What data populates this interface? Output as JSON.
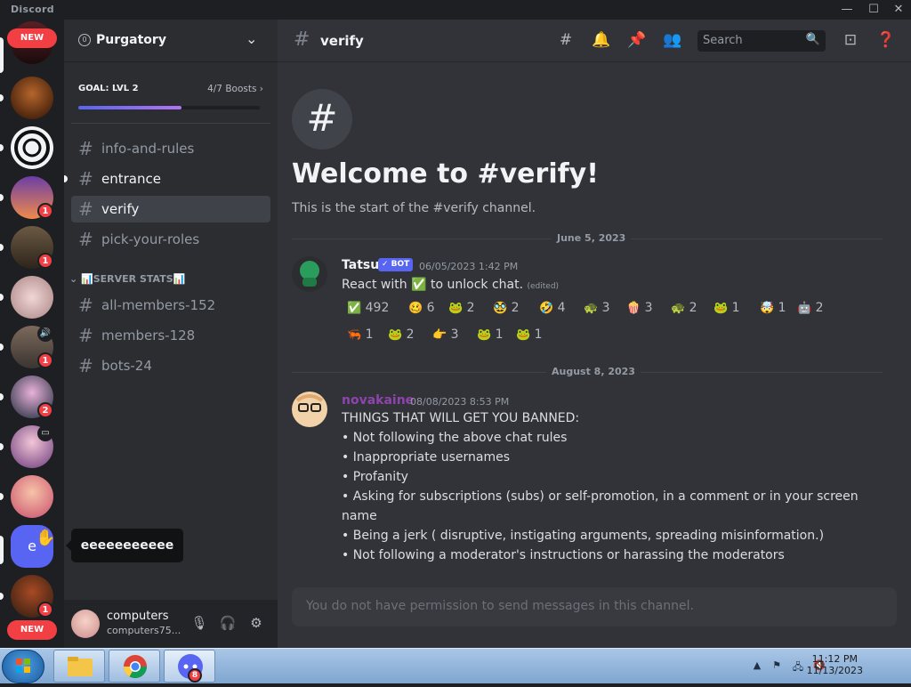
{
  "window": {
    "title": "Discord",
    "minimize": "—",
    "maximize": "☐",
    "close": "✕"
  },
  "rail": {
    "new_top": "NEW",
    "new_bottom": "NEW",
    "badges": [
      "1",
      "1",
      "1",
      "2",
      "1"
    ],
    "tooltip": "eeeeeeeeeee",
    "hovered_server_letter": "e"
  },
  "guild": {
    "name": "Purgatory",
    "goal": "GOAL: LVL 2",
    "boosts": "4/7 Boosts",
    "boost_progress": 0.57
  },
  "channels": {
    "top": [
      {
        "name": "info-and-rules"
      },
      {
        "name": "entrance"
      },
      {
        "name": "verify"
      },
      {
        "name": "pick-your-roles"
      }
    ],
    "category": "SERVER STATS",
    "stats": [
      {
        "name": "all-members-152"
      },
      {
        "name": "members-128"
      },
      {
        "name": "bots-24"
      }
    ]
  },
  "user": {
    "name": "computers",
    "tag": "computers75..."
  },
  "header": {
    "channel": "verify",
    "search_placeholder": "Search"
  },
  "welcome": {
    "title": "Welcome to #verify!",
    "subtitle": "This is the start of the #verify channel."
  },
  "messages": [
    {
      "date": "June 5, 2023",
      "author": "Tatsu",
      "author_color": "#f2f3f5",
      "bot": "✓ BOT",
      "timestamp": "06/05/2023 1:42 PM",
      "text_before": "React with",
      "text_after": "to unlock chat.",
      "edited": "(edited)",
      "reactions": [
        {
          "emoji": "✅",
          "count": "492"
        },
        {
          "emoji": "🥴",
          "count": "6"
        },
        {
          "emoji": "🐸",
          "count": "2"
        },
        {
          "emoji": "🥸",
          "count": "2"
        },
        {
          "emoji": "🤣",
          "count": "4"
        },
        {
          "emoji": "🐢",
          "count": "3"
        },
        {
          "emoji": "🍿",
          "count": "3"
        },
        {
          "emoji": "🐢",
          "count": "2"
        },
        {
          "emoji": "🐸",
          "count": "1"
        },
        {
          "emoji": "🤯",
          "count": "1"
        },
        {
          "emoji": "🤖",
          "count": "2"
        },
        {
          "emoji": "🦐",
          "count": "1"
        },
        {
          "emoji": "🐸",
          "count": "2"
        },
        {
          "emoji": "👉",
          "count": "3"
        },
        {
          "emoji": "🐸",
          "count": "1"
        },
        {
          "emoji": "🐸",
          "count": "1"
        }
      ]
    },
    {
      "date": "August 8, 2023",
      "author": "novakaine",
      "author_color": "#8e44ad",
      "timestamp": "08/08/2023 8:53 PM",
      "lines": [
        "THINGS THAT WILL GET YOU BANNED:",
        "• Not following the above chat rules",
        "• Inappropriate usernames",
        "• Profanity",
        "• Asking for subscriptions (subs)  or self-promotion, in a comment or in your screen",
        "name",
        "• Being a jerk ( disruptive, instigating arguments, spreading misinformation.)",
        "• Not following a moderator's instructions or harassing the moderators"
      ]
    }
  ],
  "composer": {
    "placeholder": "You do not have permission to send messages in this channel."
  },
  "taskbar": {
    "time": "11:12 PM",
    "date": "11/13/2023",
    "discord_badge": "8"
  },
  "colors": {
    "accent": "#5865f2",
    "danger": "#f23f43",
    "bg_main": "#313338"
  }
}
